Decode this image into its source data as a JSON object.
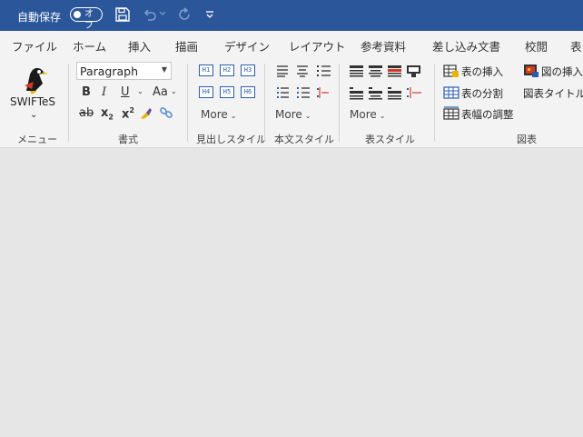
{
  "titlebar": {
    "autosave_label": "自動保存",
    "autosave_state": "オフ",
    "customize_glyph": "⌄"
  },
  "tabs": [
    "ファイル",
    "ホーム",
    "挿入",
    "描画",
    "デザイン",
    "レイアウト",
    "参考資料",
    "差し込み文書",
    "校閲",
    "表"
  ],
  "ribbon": {
    "swiftes": {
      "label": "SWIFTeS",
      "menu_glyph": "⌄",
      "group": "メニュー"
    },
    "font": {
      "style_value": "Paragraph",
      "bold": "B",
      "italic": "I",
      "underline": "U",
      "case": "Aa",
      "strike": "ab",
      "subscript": "x",
      "subscript_mark": "2",
      "superscript": "x",
      "superscript_mark": "2",
      "group": "書式"
    },
    "headings": {
      "row1": [
        "H1",
        "H2",
        "H3"
      ],
      "row2": [
        "H4",
        "H5",
        "H6"
      ],
      "more": "More",
      "group": "見出しスタイル"
    },
    "body_style": {
      "more": "More",
      "group": "本文スタイル"
    },
    "table_style": {
      "more": "More",
      "group": "表スタイル"
    },
    "table_ops": {
      "insert": "表の挿入",
      "split": "表の分割",
      "width": "表幅の調整"
    },
    "figure": {
      "insert": "図の挿入",
      "caption": "図表タイトル変",
      "group": "図表"
    }
  }
}
